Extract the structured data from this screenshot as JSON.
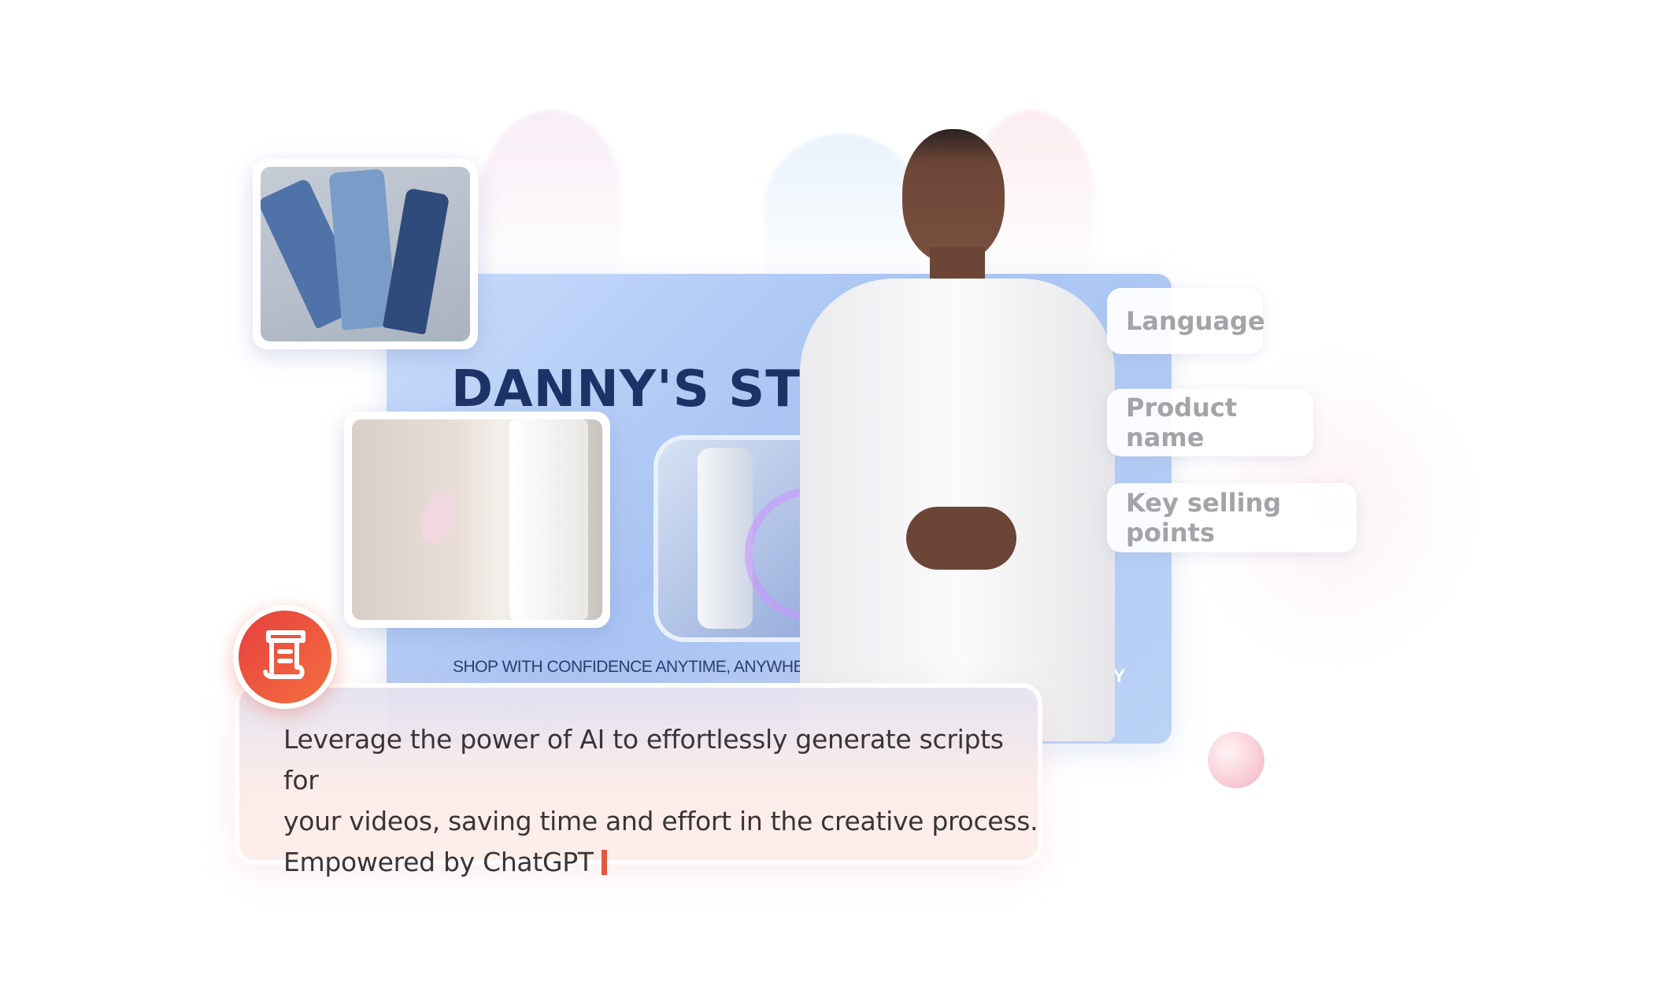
{
  "banner": {
    "store_title": "DANNY'S STORE",
    "tagline": "SHOP WITH CONFIDENCE ANYTIME, ANYWHERE",
    "corner_text": "NY"
  },
  "tags": [
    {
      "label": "Language"
    },
    {
      "label": "Product name"
    },
    {
      "label": "Key selling points"
    }
  ],
  "script_box": {
    "icon": "script-scroll-icon",
    "lines": [
      "Leverage the power of AI to effortlessly generate scripts for",
      "your videos, saving time and effort in the creative process.",
      "Empowered by ChatGPT"
    ]
  },
  "colors": {
    "accent": "#e4563e",
    "banner_title": "#1d3266",
    "tag_text": "#a3a3a8"
  }
}
